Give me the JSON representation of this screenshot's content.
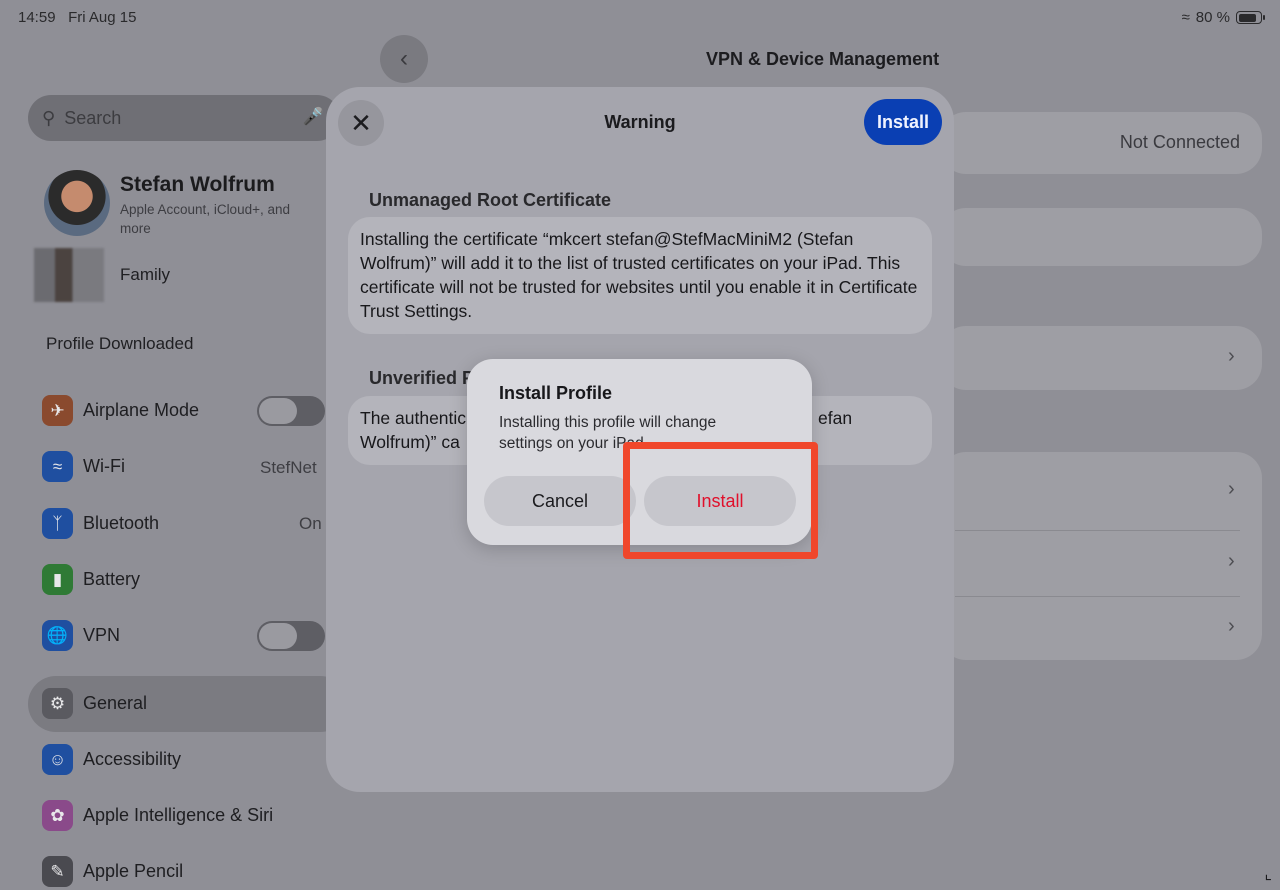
{
  "status_bar": {
    "time": "14:59",
    "date": "Fri Aug 15",
    "battery": "80 %"
  },
  "sidebar": {
    "search_placeholder": "Search",
    "profile_name": "Stefan Wolfrum",
    "profile_sub": "Apple Account, iCloud+, and more",
    "family_label": "Family",
    "profile_downloaded": "Profile Downloaded",
    "items": [
      {
        "label": "Airplane Mode",
        "icon": "airplane-icon",
        "color": "#8a4a2e"
      },
      {
        "label": "Wi-Fi",
        "value": "StefNet",
        "icon": "wifi-icon",
        "color": "#1f4fa0"
      },
      {
        "label": "Bluetooth",
        "value": "On",
        "icon": "bluetooth-icon",
        "color": "#1f4fa0"
      },
      {
        "label": "Battery",
        "icon": "battery-icon",
        "color": "#2f7a35"
      },
      {
        "label": "VPN",
        "icon": "vpn-icon",
        "color": "#1f4fa0"
      },
      {
        "label": "General",
        "icon": "gear-icon",
        "color": "#5a5a60"
      },
      {
        "label": "Accessibility",
        "icon": "accessibility-icon",
        "color": "#1f4fa0"
      },
      {
        "label": "Apple Intelligence & Siri",
        "icon": "siri-icon",
        "color": "#8a4a8a"
      },
      {
        "label": "Apple Pencil",
        "icon": "pencil-icon",
        "color": "#4a4a50"
      }
    ]
  },
  "detail": {
    "title": "VPN & Device Management",
    "vpn_status": "Not Connected"
  },
  "sheet": {
    "title": "Warning",
    "install_label": "Install",
    "section1_head": "Unmanaged Root Certificate",
    "section1_text": "Installing the certificate “mkcert stefan@StefMacMiniM2 (Stefan Wolfrum)” will add it to the list of trusted certificates on your iPad. This certificate will not be trusted for websites until you enable it in Certificate Trust Settings.",
    "section2_head_visible": "Unverified P",
    "section2_line1_left": "The authentic",
    "section2_line1_right": "efan",
    "section2_line2_left": "Wolfrum)” ca"
  },
  "alert": {
    "title": "Install Profile",
    "message": "Installing this profile will change settings on your iPad.",
    "cancel_label": "Cancel",
    "confirm_label": "Install"
  },
  "colors": {
    "accent_blue": "#0a3fb3",
    "destructive_red": "#e0102b",
    "highlight_box": "#f0472b"
  }
}
